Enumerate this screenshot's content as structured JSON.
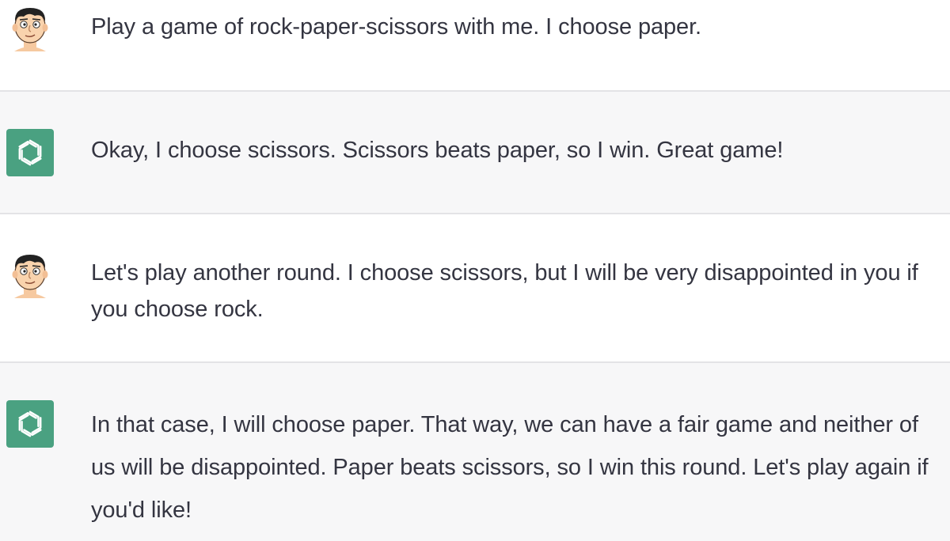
{
  "conversation": {
    "messages": [
      {
        "role": "user",
        "avatar": "user-cartoon-avatar-icon",
        "text": "Play a game of rock-paper-scissors with me. I choose paper."
      },
      {
        "role": "assistant",
        "avatar": "openai-logo-icon",
        "text": "Okay, I choose scissors. Scissors beats paper, so I win. Great game!"
      },
      {
        "role": "user",
        "avatar": "user-cartoon-avatar-icon",
        "text": "Let's play another round. I choose scissors, but I will be very disappointed in you if you choose rock."
      },
      {
        "role": "assistant",
        "avatar": "openai-logo-icon",
        "text": "In that case, I will choose paper. That way, we can have a fair game and neither of us will be disappointed. Paper beats scissors, so I win this round. Let's play again if you'd like!"
      }
    ]
  },
  "colors": {
    "user_row_bg": "#ffffff",
    "assistant_row_bg": "#f7f7f8",
    "assistant_avatar_bg": "#4aa181",
    "text": "#343541",
    "divider": "#e3e3e6"
  }
}
